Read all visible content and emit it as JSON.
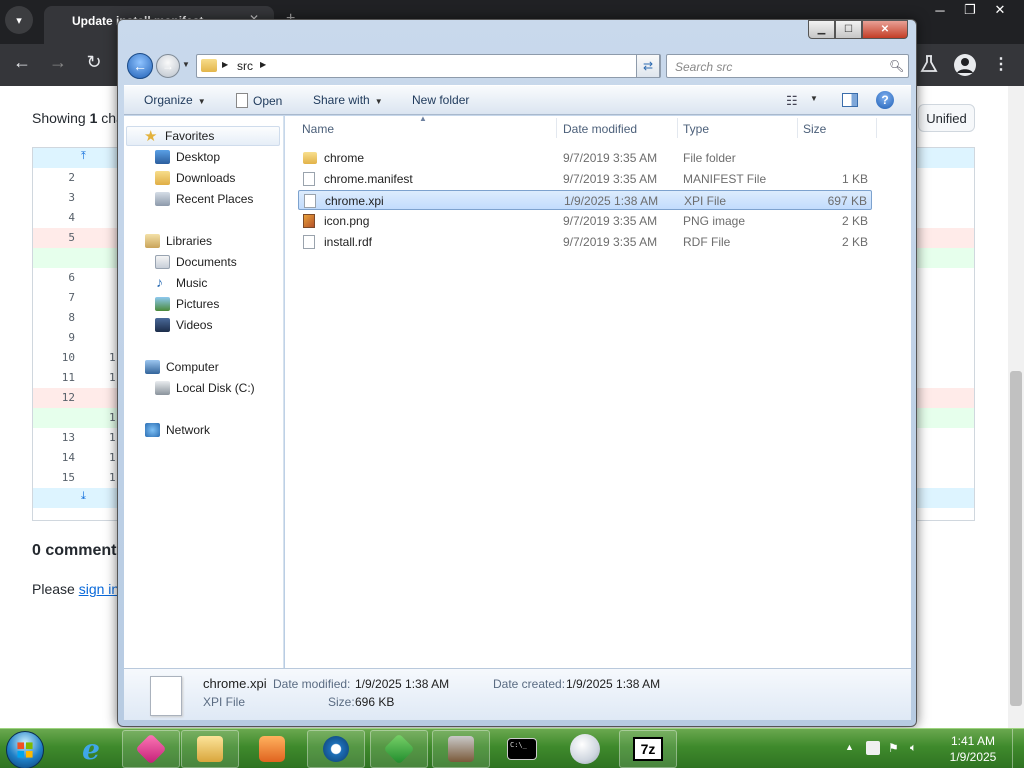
{
  "browser": {
    "tab_title": "Update install.manifest",
    "showing_prefix": "Showing",
    "showing_count": "1",
    "showing_suffix": "cha",
    "unified_label": "Unified",
    "diff_rows": [
      {
        "left": "",
        "right": "",
        "kind": "expand"
      },
      {
        "left": "2",
        "right": "",
        "kind": "ctx"
      },
      {
        "left": "3",
        "right": "",
        "kind": "ctx"
      },
      {
        "left": "4",
        "right": "",
        "kind": "ctx"
      },
      {
        "left": "5",
        "right": "",
        "kind": "del"
      },
      {
        "left": "",
        "right": "",
        "kind": "add"
      },
      {
        "left": "6",
        "right": "",
        "kind": "ctx"
      },
      {
        "left": "7",
        "right": "",
        "kind": "ctx"
      },
      {
        "left": "8",
        "right": "",
        "kind": "ctx"
      },
      {
        "left": "9",
        "right": "",
        "kind": "ctx"
      },
      {
        "left": "10",
        "right": "1",
        "kind": "ctx"
      },
      {
        "left": "11",
        "right": "1",
        "kind": "ctx"
      },
      {
        "left": "12",
        "right": "",
        "kind": "del"
      },
      {
        "left": "",
        "right": "1",
        "kind": "add"
      },
      {
        "left": "13",
        "right": "1",
        "kind": "ctx"
      },
      {
        "left": "14",
        "right": "1",
        "kind": "ctx"
      },
      {
        "left": "15",
        "right": "1",
        "kind": "ctx"
      },
      {
        "left": "",
        "right": "",
        "kind": "expand"
      }
    ],
    "comments_heading": "0 comments",
    "signin_prefix": "Please",
    "signin_link": "sign in"
  },
  "explorer": {
    "address_path": "src",
    "search_placeholder": "Search src",
    "commands": {
      "organize": "Organize",
      "open": "Open",
      "share_with": "Share with",
      "new_folder": "New folder"
    },
    "nav": {
      "favorites": "Favorites",
      "desktop": "Desktop",
      "downloads": "Downloads",
      "recent_places": "Recent Places",
      "libraries": "Libraries",
      "documents": "Documents",
      "music": "Music",
      "pictures": "Pictures",
      "videos": "Videos",
      "computer": "Computer",
      "local_disk": "Local Disk (C:)",
      "network": "Network"
    },
    "columns": {
      "name": "Name",
      "date_modified": "Date modified",
      "type": "Type",
      "size": "Size"
    },
    "files": [
      {
        "name": "chrome",
        "date": "9/7/2019 3:35 AM",
        "type": "File folder",
        "size": "",
        "icon": "folder-icon",
        "selected": false
      },
      {
        "name": "chrome.manifest",
        "date": "9/7/2019 3:35 AM",
        "type": "MANIFEST File",
        "size": "1 KB",
        "icon": "file-icon",
        "selected": false
      },
      {
        "name": "chrome.xpi",
        "date": "1/9/2025 1:38 AM",
        "type": "XPI File",
        "size": "697 KB",
        "icon": "file-icon",
        "selected": true
      },
      {
        "name": "icon.png",
        "date": "9/7/2019 3:35 AM",
        "type": "PNG image",
        "size": "2 KB",
        "icon": "image-icon",
        "selected": false
      },
      {
        "name": "install.rdf",
        "date": "9/7/2019 3:35 AM",
        "type": "RDF File",
        "size": "2 KB",
        "icon": "file-icon",
        "selected": false
      }
    ],
    "details": {
      "name": "chrome.xpi",
      "type": "XPI File",
      "date_modified_label": "Date modified:",
      "date_modified": "1/9/2025 1:38 AM",
      "size_label": "Size:",
      "size": "696 KB",
      "date_created_label": "Date created:",
      "date_created": "1/9/2025 1:38 AM"
    }
  },
  "taskbar": {
    "time": "1:41 AM",
    "date": "1/9/2025",
    "apps": [
      "app-icon",
      "folder-icon",
      "media-player-icon",
      "browser-icon",
      "app-icon",
      "app-icon",
      "terminal-icon",
      "app-icon",
      "7zip-icon"
    ],
    "terminal_glyph": "C:\\_",
    "sevenzip_glyph": "7z"
  },
  "colors": {
    "taskbar_green": "#3f8a2c",
    "selection_blue": "#c2dcfd",
    "chrome_dark": "#202124"
  }
}
